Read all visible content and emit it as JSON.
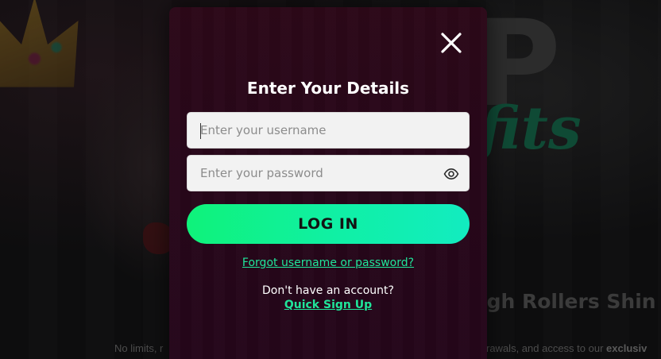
{
  "modal": {
    "title": "Enter Your Details",
    "close_icon": "close-icon",
    "username": {
      "placeholder": "Enter your username",
      "value": ""
    },
    "password": {
      "placeholder": "Enter your password",
      "value": "",
      "toggle_icon": "eye-icon"
    },
    "login_label": "LOG IN",
    "forgot_label": "Forgot username or password?",
    "no_account_label": "Don't have an account?",
    "signup_label": "Quick Sign Up"
  },
  "background": {
    "big_letter": "P",
    "script_text": "fits",
    "tagline": "igh Rollers Shin",
    "footer_left": "No limits, r",
    "footer_right_prefix": "rawals, and access to our ",
    "footer_right_bold": "exclusiv"
  },
  "colors": {
    "accent": "#20e59a",
    "button_gradient_start": "#0ff27a",
    "button_gradient_end": "#12ecc0",
    "modal_bg": "#2a0819",
    "page_bg": "#0d0d0e"
  }
}
